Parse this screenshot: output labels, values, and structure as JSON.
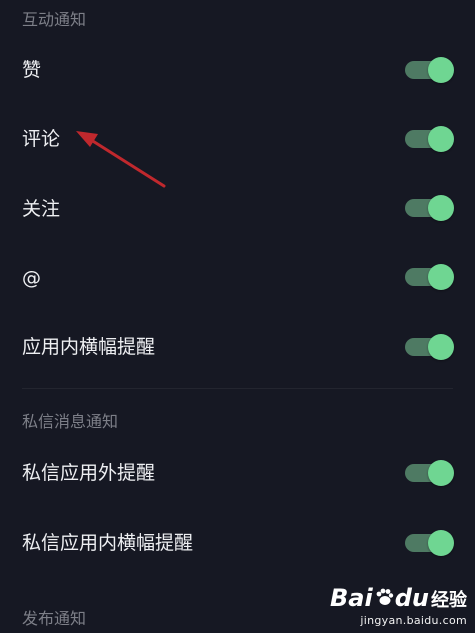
{
  "sections": {
    "interaction": {
      "title": "互动通知"
    },
    "messages": {
      "title": "私信消息通知"
    },
    "publish": {
      "title": "发布通知"
    }
  },
  "items": {
    "likes": {
      "label": "赞",
      "enabled": true
    },
    "comments": {
      "label": "评论",
      "enabled": true
    },
    "follows": {
      "label": "关注",
      "enabled": true
    },
    "mentions": {
      "label": "@",
      "enabled": true
    },
    "in_app_banner": {
      "label": "应用内横幅提醒",
      "enabled": true
    },
    "dm_out_of_app": {
      "label": "私信应用外提醒",
      "enabled": true
    },
    "dm_in_app_banner": {
      "label": "私信应用内横幅提醒",
      "enabled": true
    }
  },
  "colors": {
    "background": "#161823",
    "toggle_on_knob": "#6fd692",
    "toggle_on_track": "#4e7a63",
    "annotation_arrow": "#c0282d"
  },
  "watermark": {
    "brand_prefix": "Bai",
    "brand_suffix": "du",
    "brand_cn": "经验",
    "url": "jingyan.baidu.com"
  }
}
